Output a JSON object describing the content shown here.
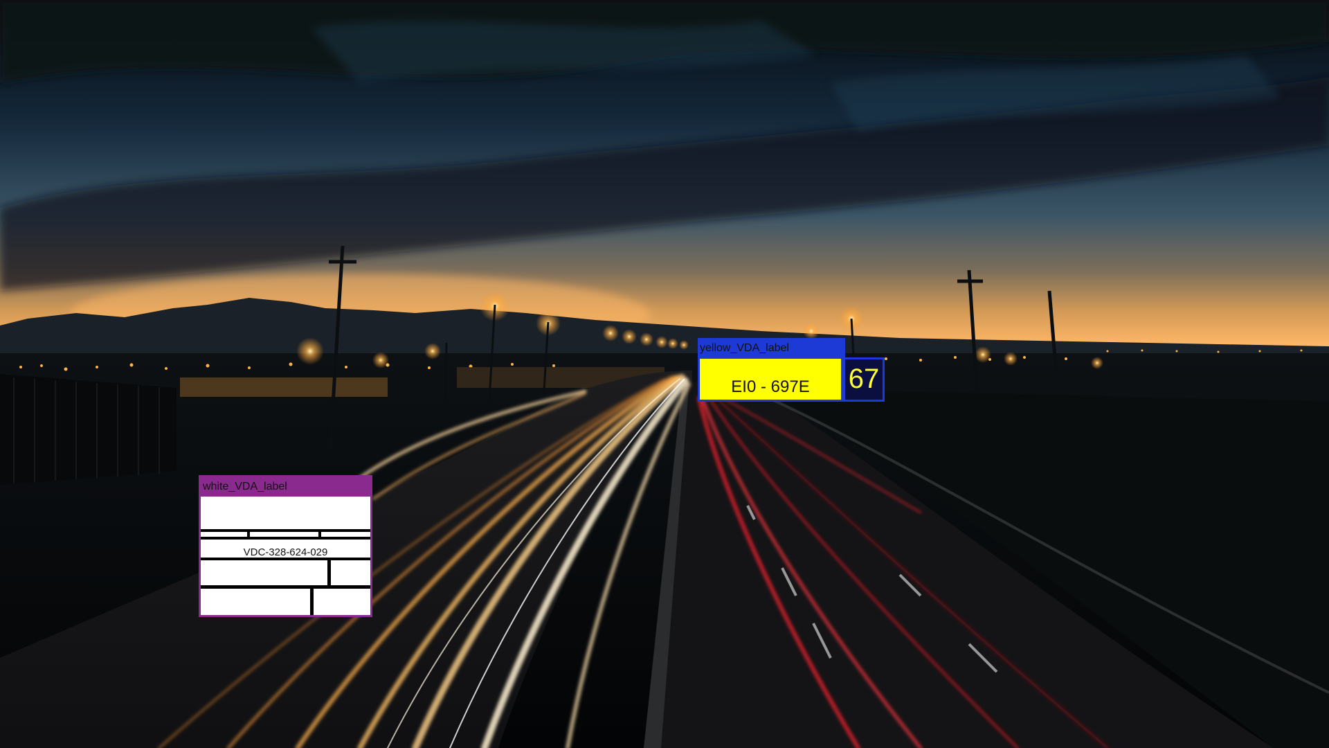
{
  "detections": {
    "white": {
      "label": "white_VDA_label",
      "code": "VDC-328-624-029"
    },
    "yellow": {
      "label": "yellow_VDA_label",
      "plate": "EI0 - 697E",
      "number": "67"
    }
  },
  "colors": {
    "white_box": "#8a2a8e",
    "yellow_box": "#1d3ad6",
    "yellow_plate": "#ffff00"
  }
}
